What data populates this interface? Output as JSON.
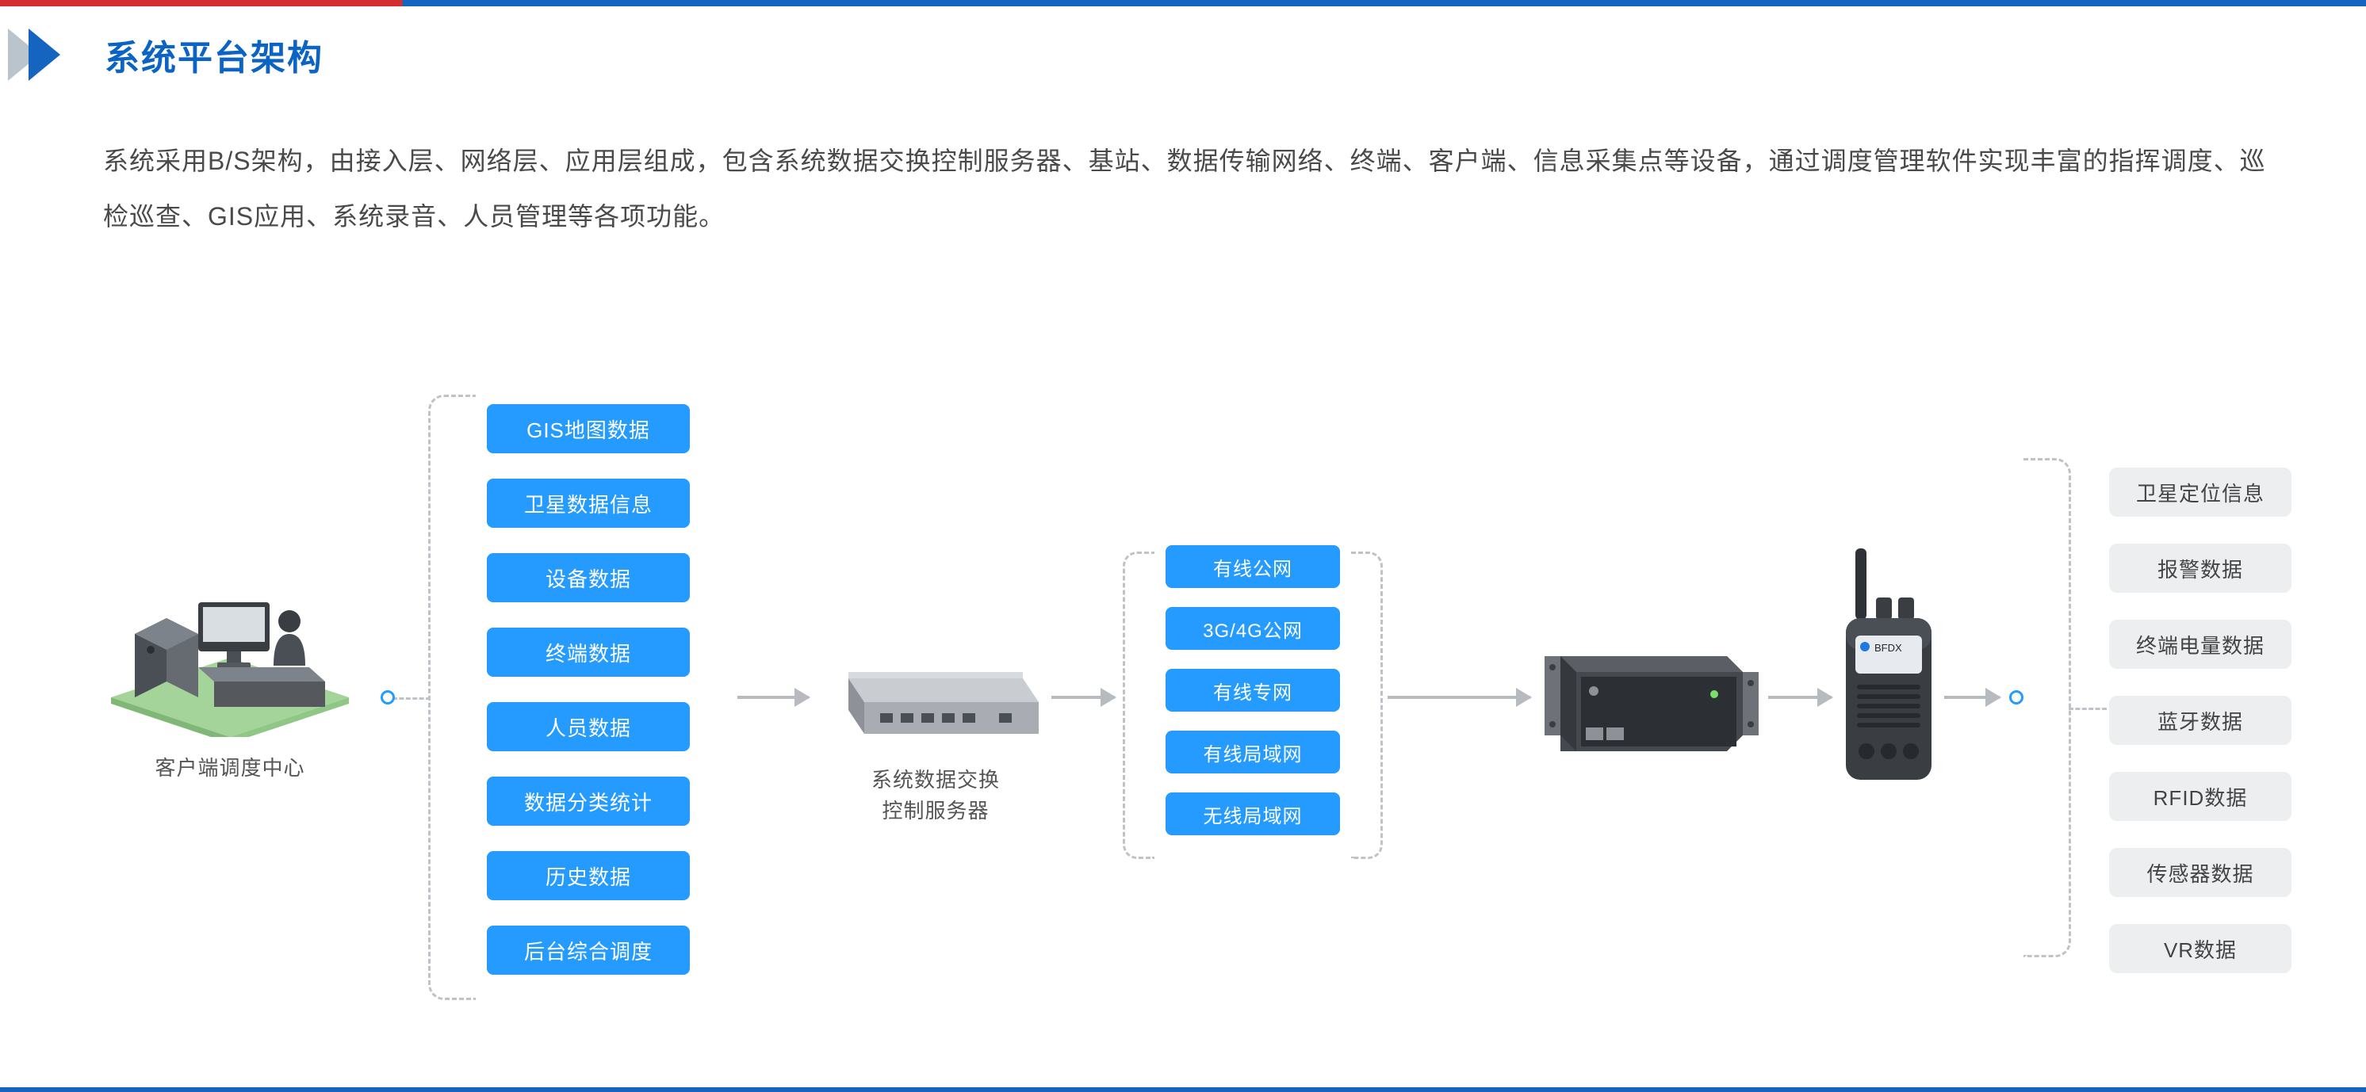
{
  "title": "系统平台架构",
  "description": "系统采用B/S架构，由接入层、网络层、应用层组成，包含系统数据交换控制服务器、基站、数据传输网络、终端、客户端、信息采集点等设备，通过调度管理软件实现丰富的指挥调度、巡检巡查、GIS应用、系统录音、人员管理等各项功能。",
  "client": {
    "caption": "客户端调度中心",
    "items": [
      "GIS地图数据",
      "卫星数据信息",
      "设备数据",
      "终端数据",
      "人员数据",
      "数据分类统计",
      "历史数据",
      "后台综合调度"
    ]
  },
  "server": {
    "caption": "系统数据交换\n控制服务器"
  },
  "network": {
    "items": [
      "有线公网",
      "3G/4G公网",
      "有线专网",
      "有线局域网",
      "无线局域网"
    ]
  },
  "base_station": {
    "caption": ""
  },
  "terminal": {
    "brand": "BFDX",
    "items": [
      "卫星定位信息",
      "报警数据",
      "终端电量数据",
      "蓝牙数据",
      "RFID数据",
      "传感器数据",
      "VR数据"
    ]
  },
  "icons": {
    "title_arrow": "triangle-arrow",
    "workstation": "desktop-user-icon",
    "switch": "network-switch-icon",
    "rack": "server-rack-icon",
    "radio": "walkie-talkie-icon"
  },
  "colors": {
    "brand_blue": "#0b63c4",
    "pill_blue": "#259bff",
    "connector_gray": "#bfc3c8",
    "gray_pill": "#eceef0"
  }
}
